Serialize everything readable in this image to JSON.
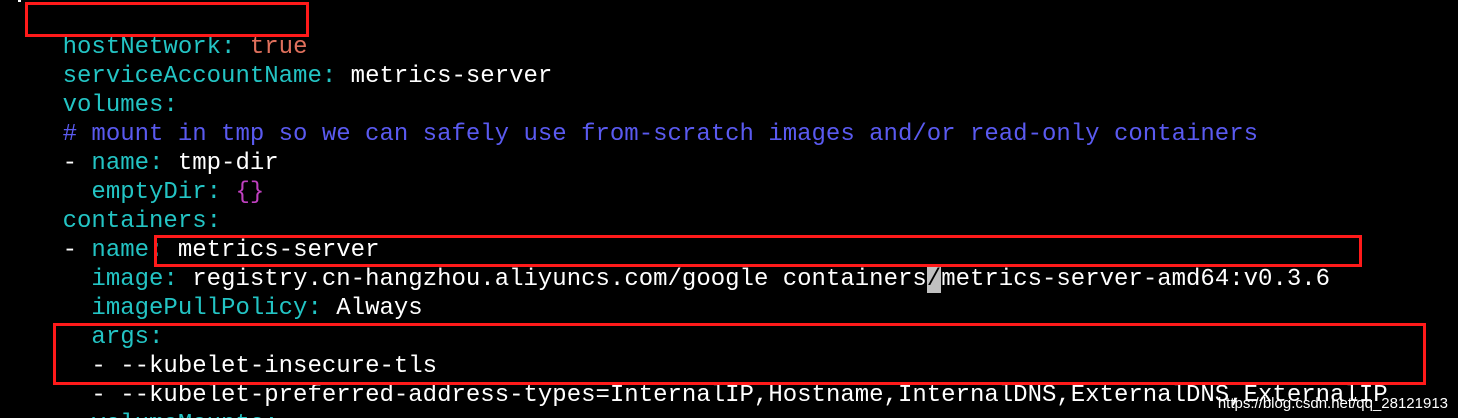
{
  "editor": {
    "lines": {
      "l1": {
        "key": "hostNetwork",
        "value": "true"
      },
      "l2": {
        "key": "serviceAccountName",
        "value": "metrics-server"
      },
      "l3": {
        "key": "volumes"
      },
      "l4": {
        "comment": "# mount in tmp so we can safely use from-scratch images and/or read-only containers"
      },
      "l5": {
        "dash": "-",
        "key": "name",
        "value": "tmp-dir"
      },
      "l6": {
        "key": "emptyDir",
        "value": "{}"
      },
      "l7": {
        "key": "containers"
      },
      "l8": {
        "dash": "-",
        "key": "name",
        "value": "metrics-server"
      },
      "l9": {
        "key": "image",
        "value_before_cursor": "registry.cn-hangzhou.aliyuncs.com/google containers",
        "cursor_char": "/",
        "value_after_cursor": "metrics-server-amd64:v0.3.6"
      },
      "l10": {
        "key": "imagePullPolicy",
        "value": "Always"
      },
      "l11": {
        "key": "args"
      },
      "l12": {
        "text": "- --kubelet-insecure-tls"
      },
      "l13": {
        "text": "- --kubelet-preferred-address-types=InternalIP,Hostname,InternalDNS,ExternalDNS,ExternalIP"
      },
      "l14": {
        "key": "volumeMounts"
      }
    },
    "colors": {
      "background": "#000000",
      "key": "#23c4c4",
      "value": "#ffffff",
      "boolean": "#e0705c",
      "brace": "#c040c0",
      "comment": "#5a5af0",
      "highlight_box": "#ff1a1a"
    }
  },
  "watermark": "https://blog.csdn.net/qq_28121913"
}
